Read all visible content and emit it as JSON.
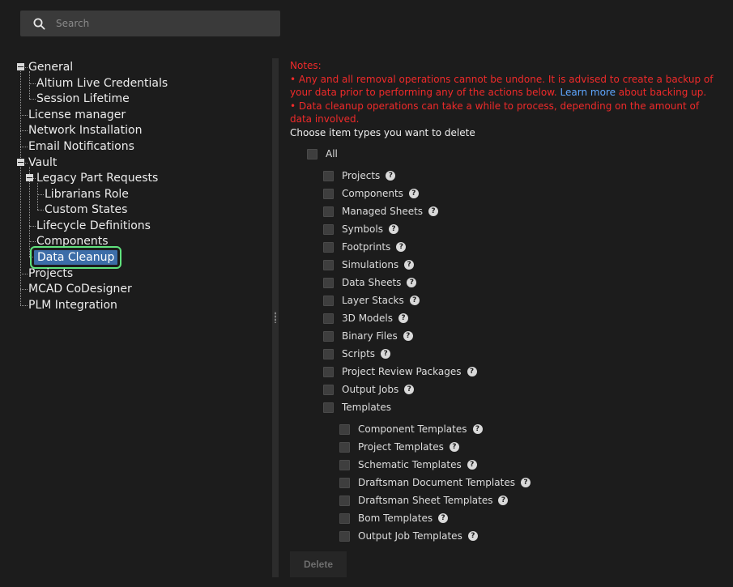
{
  "search": {
    "placeholder": "Search"
  },
  "tree": {
    "general": "General",
    "altium_live_credentials": "Altium Live Credentials",
    "session_lifetime": "Session Lifetime",
    "license_manager": "License manager",
    "network_installation": "Network Installation",
    "email_notifications": "Email Notifications",
    "vault": "Vault",
    "legacy_part_requests": "Legacy Part Requests",
    "librarians_role": "Librarians Role",
    "custom_states": "Custom States",
    "lifecycle_definitions": "Lifecycle Definitions",
    "components": "Components",
    "data_cleanup": "Data Cleanup",
    "projects": "Projects",
    "mcad_codesigner": "MCAD CoDesigner",
    "plm_integration": "PLM Integration"
  },
  "notes": {
    "heading": "Notes:",
    "line1_pre": "• Any and all removal operations cannot be undone. It is advised to create a backup of your data prior to performing any of the actions below. ",
    "line1_link": "Learn more",
    "line1_post": " about backing up.",
    "line2": "• Data cleanup operations can take a while to process, depending on the amount of data involved."
  },
  "choose_label": "Choose item types you want to delete",
  "all_label": "All",
  "items": {
    "projects": "Projects",
    "components": "Components",
    "managed_sheets": "Managed Sheets",
    "symbols": "Symbols",
    "footprints": "Footprints",
    "simulations": "Simulations",
    "data_sheets": "Data Sheets",
    "layer_stacks": "Layer Stacks",
    "3d_models": "3D Models",
    "binary_files": "Binary Files",
    "scripts": "Scripts",
    "project_review_packages": "Project Review Packages",
    "output_jobs": "Output Jobs",
    "templates": "Templates"
  },
  "templates": {
    "component_templates": "Component Templates",
    "project_templates": "Project Templates",
    "schematic_templates": "Schematic Templates",
    "draftsman_document_templates": "Draftsman Document Templates",
    "draftsman_sheet_templates": "Draftsman Sheet Templates",
    "bom_templates": "Bom Templates",
    "output_job_templates": "Output Job Templates"
  },
  "help_glyph": "?",
  "delete_label": "Delete"
}
